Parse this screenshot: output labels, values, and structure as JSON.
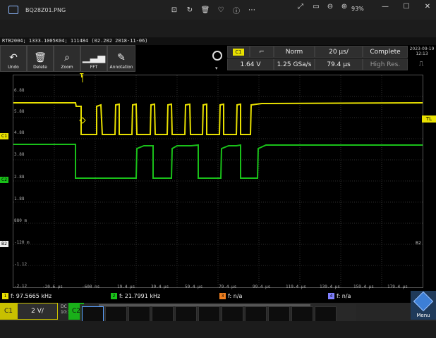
{
  "viewer": {
    "filename": "BQ28Z01.PNG",
    "zoom": "93%",
    "tools": [
      "crop-icon",
      "rotate-icon",
      "delete-icon",
      "favorite-icon",
      "info-icon",
      "more-icon"
    ]
  },
  "instrument": {
    "id_line": "RTB2004; 1333.1005K04; 111484 (02.202 2018-11-06)",
    "date": "2023-09-19",
    "time": "12:13"
  },
  "toolbar": {
    "undo": "Undo",
    "delete": "Delete",
    "zoom": "Zoom",
    "fft": "FFT",
    "annotation": "Annotation"
  },
  "trigger": {
    "channel": "C1",
    "slope": "⌐",
    "mode": "Norm",
    "timebase": "20 µs/",
    "state": "Complete",
    "level": "1.64 V",
    "sample_rate": "1.25 GSa/s",
    "position": "79.4 µs",
    "acq_mode": "High Res."
  },
  "yaxis_labels": [
    "6.88",
    "5.88",
    "4.88",
    "3.88",
    "2.88",
    "1.88",
    "880 m",
    "-120 m",
    "-1.12",
    "-2.12"
  ],
  "xaxis_labels": [
    "-20.6 µs",
    "-600 ns",
    "19.4 µs",
    "39.4 µs",
    "59.4 µs",
    "79.4 µs",
    "99.4 µs",
    "119.4 µs",
    "139.4 µs",
    "159.4 µs",
    "179.4 µs"
  ],
  "markers": {
    "c1": "C1",
    "c2": "C2",
    "b2_left": "B2",
    "b2_right": "B2",
    "tl": "TL",
    "t": "T"
  },
  "measurements": [
    {
      "channel": "C1",
      "text": "f: 97.5665 kHz",
      "color": "#e8e000"
    },
    {
      "channel": "C2",
      "text": "f: 21.7991 kHz",
      "color": "#19c019"
    },
    {
      "channel": "C3",
      "text": "f: n/a",
      "color": "#f08020"
    },
    {
      "channel": "C4",
      "text": "f: n/a",
      "color": "#8080ff"
    }
  ],
  "bottom": {
    "c1_label": "C1",
    "c1_scale": "2 V/",
    "coupling": "DC",
    "coupling_sub": "10:1",
    "c2_label": "C2",
    "menu": "Menu"
  },
  "colors": {
    "ch1": "#e8e000",
    "ch2": "#19c019"
  }
}
